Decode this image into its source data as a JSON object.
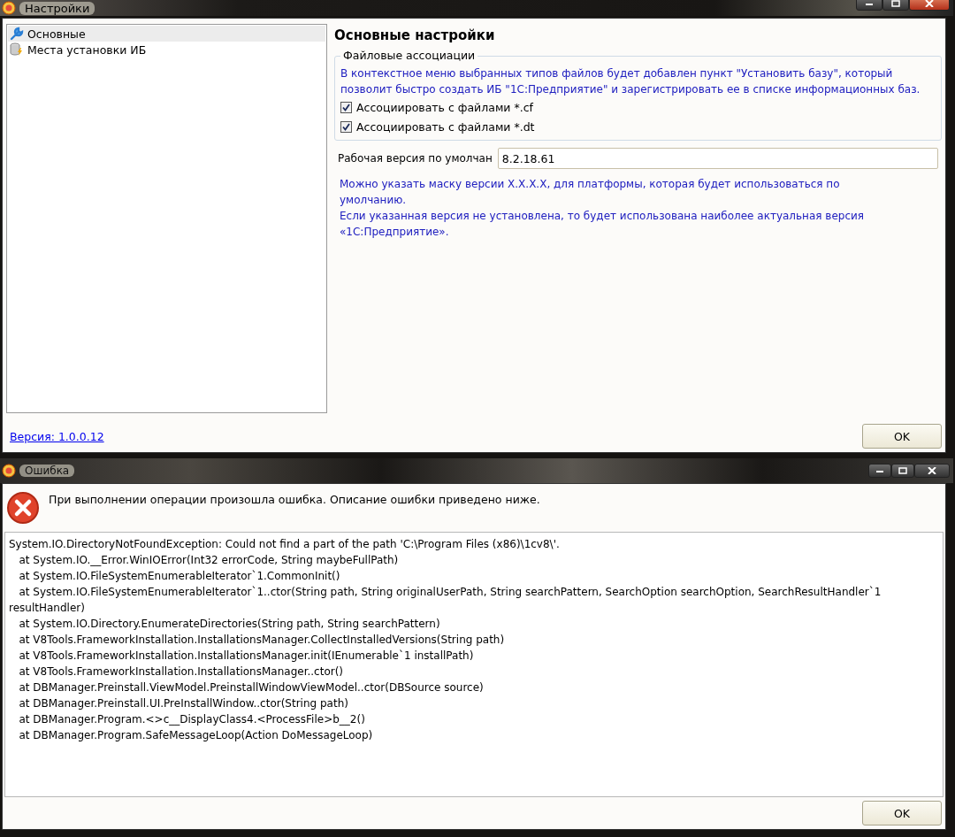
{
  "settings_window": {
    "title": "Настройки",
    "sidebar": {
      "items": [
        {
          "label": "Основные",
          "kind": "wrench",
          "selected": true
        },
        {
          "label": "Места установки ИБ",
          "kind": "database",
          "selected": false
        }
      ]
    },
    "panel": {
      "heading": "Основные настройки",
      "group": {
        "legend": "Файловые ассоциации",
        "description": "В контекстное меню выбранных типов файлов будет добавлен пункт \"Установить базу\", который позволит быстро создать ИБ \"1С:Предприятие\" и зарегистрировать ее в списке информационных баз.",
        "checkboxes": [
          {
            "label": "Ассоциировать с файлами *.cf",
            "checked": true
          },
          {
            "label": "Ассоциировать с файлами *.dt",
            "checked": true
          }
        ]
      },
      "default_version": {
        "label": "Рабочая версия по умолчан",
        "value": "8.2.18.61"
      },
      "hint": [
        "Можно указать маску версии X.X.X.X, для платформы, которая будет использоваться по умолчанию.",
        "Если указанная версия не установлена, то будет использована наиболее актуальная версия «1С:Предприятие»."
      ]
    },
    "version_link": "Версия: 1.0.0.12",
    "ok_button": "OK"
  },
  "error_window": {
    "title": "Ошибка",
    "message": "При выполнении операции произошла ошибка. Описание ошибки приведено ниже.",
    "details": [
      "System.IO.DirectoryNotFoundException: Could not find a part of the path 'C:\\Program Files (x86)\\1cv8\\'.",
      "   at System.IO.__Error.WinIOError(Int32 errorCode, String maybeFullPath)",
      "   at System.IO.FileSystemEnumerableIterator`1.CommonInit()",
      "   at System.IO.FileSystemEnumerableIterator`1..ctor(String path, String originalUserPath, String searchPattern, SearchOption searchOption, SearchResultHandler`1 resultHandler)",
      "   at System.IO.Directory.EnumerateDirectories(String path, String searchPattern)",
      "   at V8Tools.FrameworkInstallation.InstallationsManager.CollectInstalledVersions(String path)",
      "   at V8Tools.FrameworkInstallation.InstallationsManager.init(IEnumerable`1 installPath)",
      "   at V8Tools.FrameworkInstallation.InstallationsManager..ctor()",
      "   at DBManager.Preinstall.ViewModel.PreinstallWindowViewModel..ctor(DBSource source)",
      "   at DBManager.Preinstall.UI.PreInstallWindow..ctor(String path)",
      "   at DBManager.Program.<>c__DisplayClass4.<ProcessFile>b__2()",
      "   at DBManager.Program.SafeMessageLoop(Action DoMessageLoop)"
    ],
    "ok_button": "OK"
  }
}
